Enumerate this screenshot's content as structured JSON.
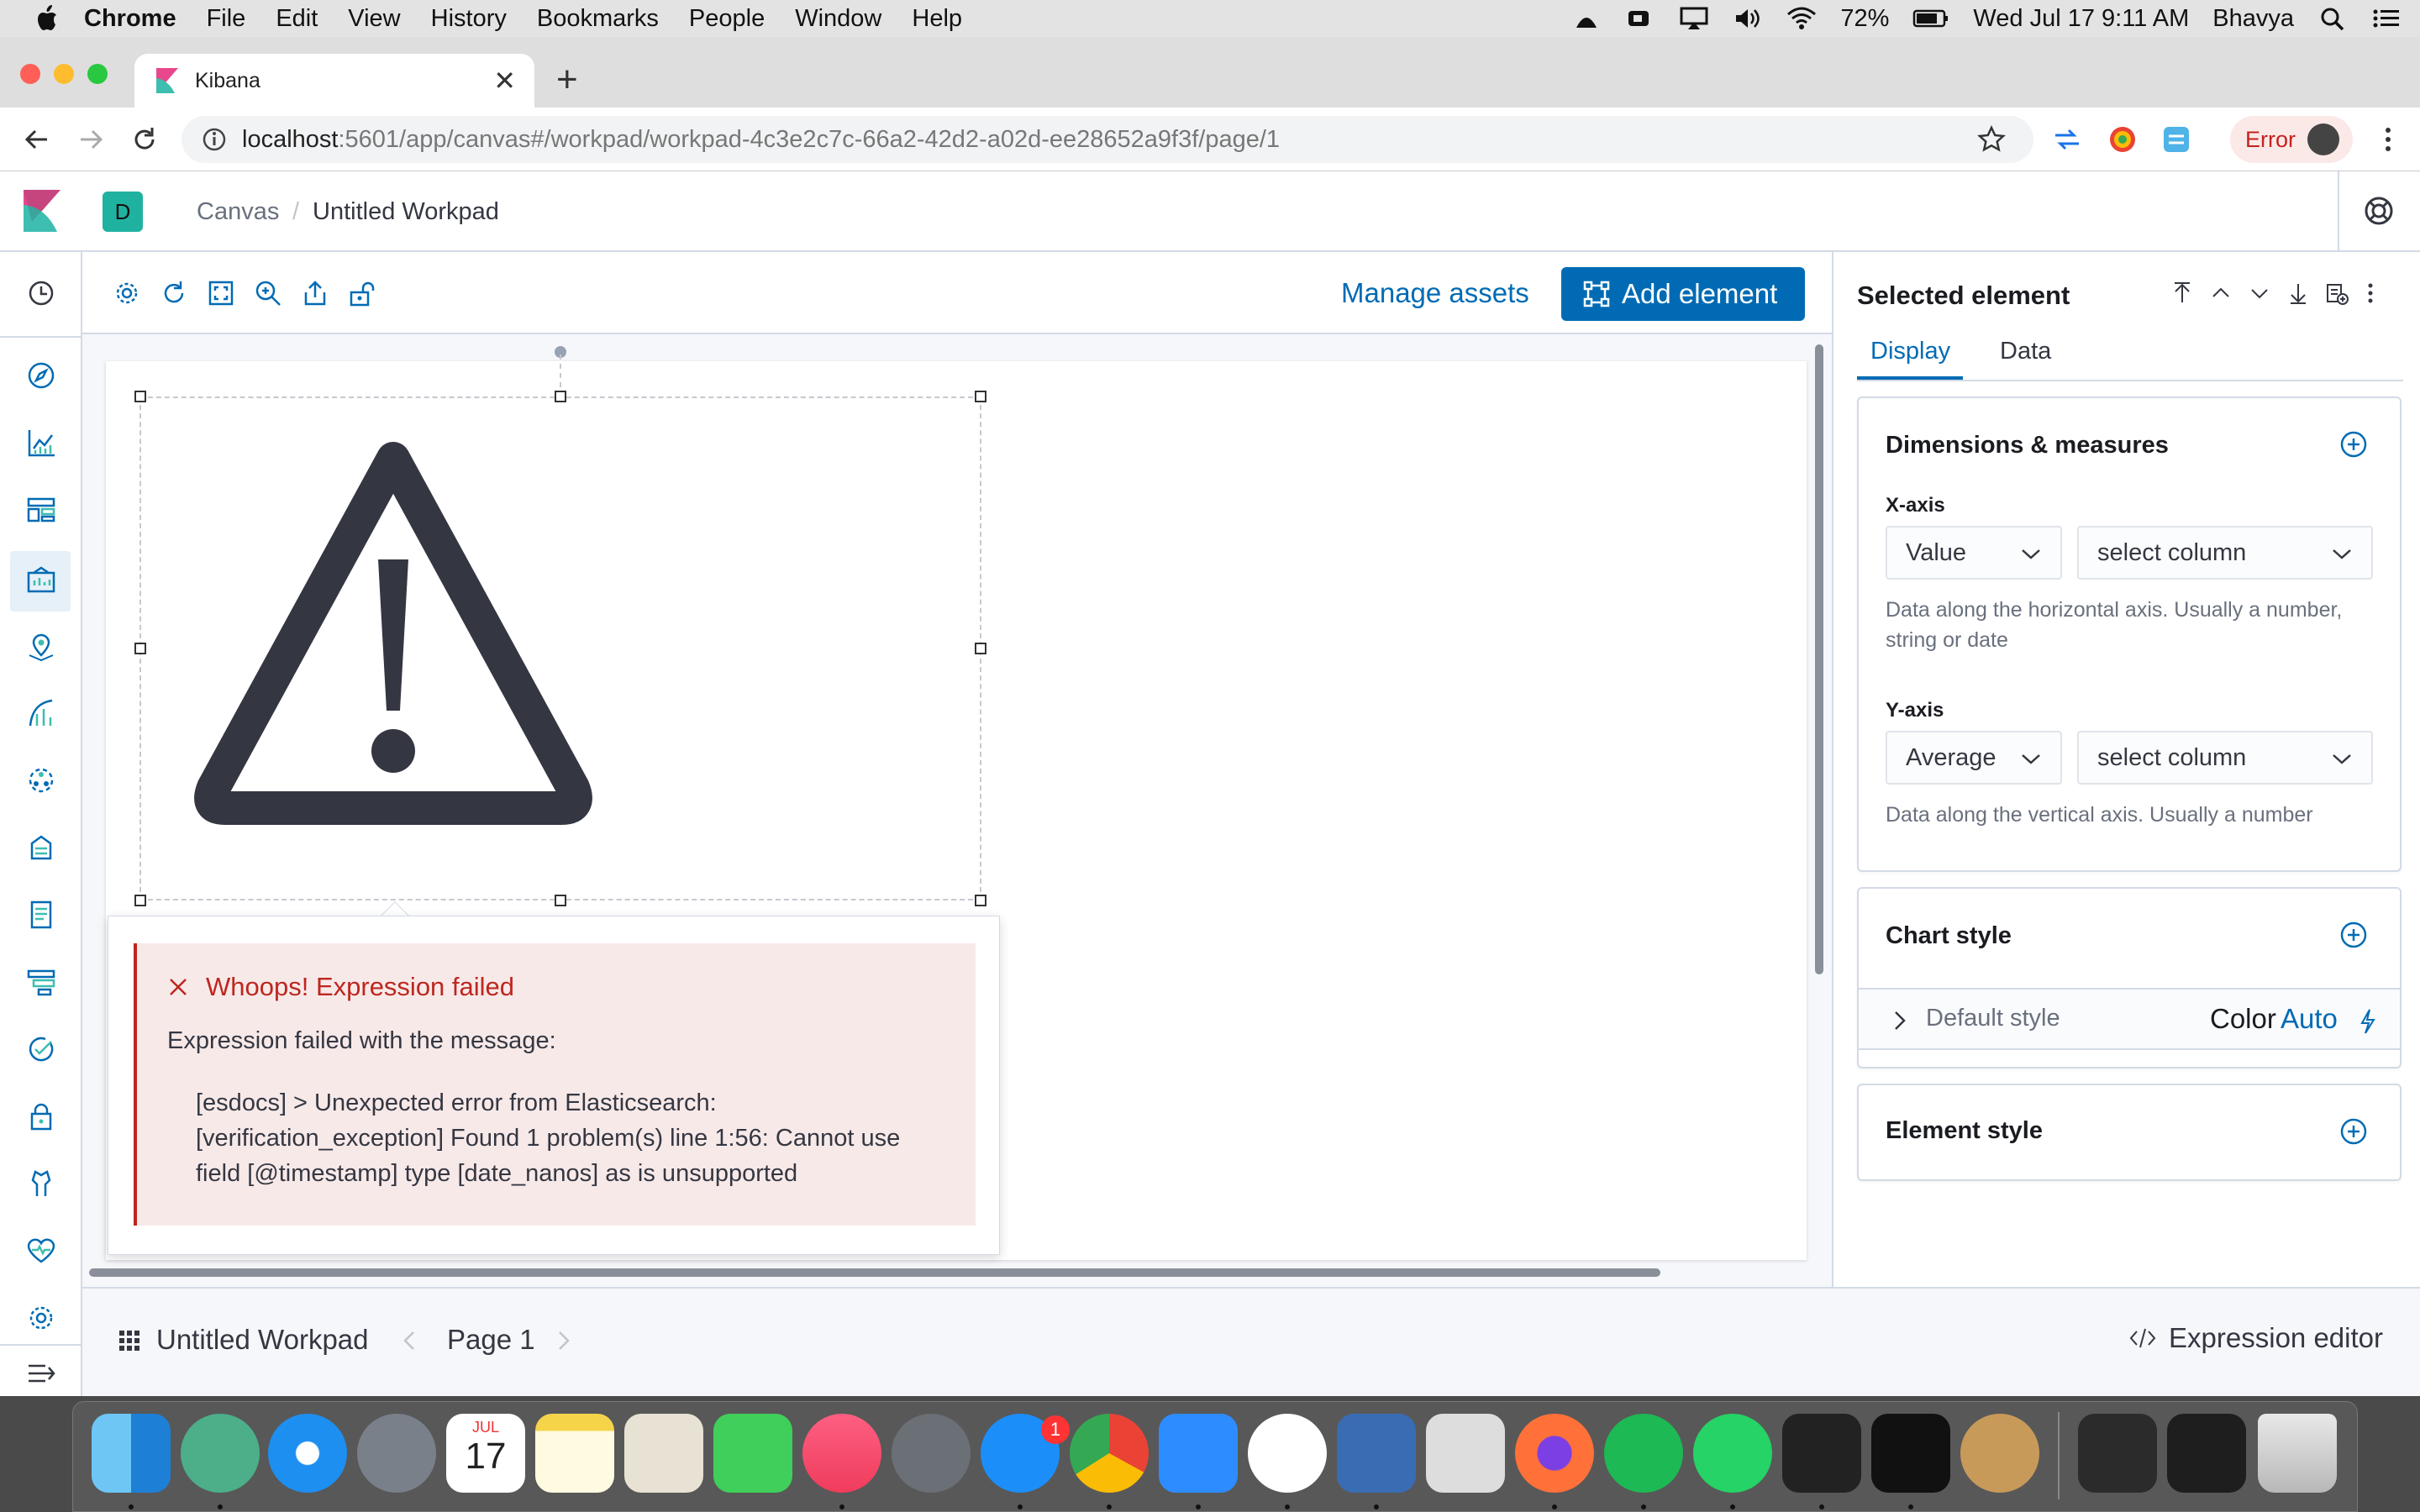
{
  "menubar": {
    "app": "Chrome",
    "items": [
      "File",
      "Edit",
      "View",
      "History",
      "Bookmarks",
      "People",
      "Window",
      "Help"
    ],
    "battery": "72%",
    "datetime": "Wed Jul 17  9:11 AM",
    "user": "Bhavya"
  },
  "browser": {
    "tab_title": "Kibana",
    "url_host": "localhost",
    "url_rest": ":5601/app/canvas#/workpad/workpad-4c3e2c7c-66a2-42d2-a02d-ee28652a9f3f/page/1",
    "error_label": "Error"
  },
  "kibana": {
    "space_letter": "D",
    "breadcrumb_app": "Canvas",
    "breadcrumb_page": "Untitled Workpad"
  },
  "toolbar": {
    "manage_assets": "Manage assets",
    "add_element": "Add element"
  },
  "error": {
    "title": "Whoops! Expression failed",
    "message_label": "Expression failed with the message:",
    "detail": "[esdocs] > Unexpected error from Elasticsearch: [verification_exception] Found 1 problem(s) line 1:56: Cannot use field [@timestamp] type [date_nanos] as is unsupported"
  },
  "panel": {
    "title": "Selected element",
    "tabs": [
      "Display",
      "Data"
    ],
    "active_tab": "Display",
    "dimensions": {
      "title": "Dimensions & measures",
      "x_label": "X-axis",
      "x_type": "Value",
      "x_column": "select column",
      "x_hint": "Data along the horizontal axis. Usually a number, string or date",
      "y_label": "Y-axis",
      "y_type": "Average",
      "y_column": "select column",
      "y_hint": "Data along the vertical axis. Usually a number"
    },
    "chart_style": {
      "title": "Chart style",
      "default_style": "Default style",
      "color_label": "Color",
      "color_value": "Auto"
    },
    "element_style": {
      "title": "Element style"
    }
  },
  "footer": {
    "workpad_name": "Untitled Workpad",
    "page_label": "Page 1",
    "expression_editor": "Expression editor"
  },
  "dock": {
    "calendar_month": "JUL",
    "calendar_day": "17",
    "appstore_badge": "1"
  },
  "colors": {
    "primary": "#006bb4",
    "danger": "#bd271e",
    "kibana_pink": "#e8488b",
    "kibana_teal": "#3ebeb0"
  }
}
